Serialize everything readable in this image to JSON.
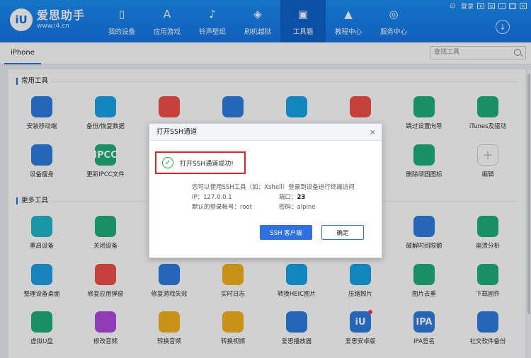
{
  "app": {
    "name": "爱思助手",
    "url": "www.i4.cn",
    "logo_text": "iU"
  },
  "window_controls": {
    "login": "登录"
  },
  "nav": [
    {
      "label": "我的设备",
      "icon": "phone-icon"
    },
    {
      "label": "应用游戏",
      "icon": "app-store-icon"
    },
    {
      "label": "铃声壁纸",
      "icon": "music-icon"
    },
    {
      "label": "刷机越狱",
      "icon": "box-icon"
    },
    {
      "label": "工具箱",
      "icon": "toolbox-icon",
      "active": true
    },
    {
      "label": "教程中心",
      "icon": "graduation-cap-icon"
    },
    {
      "label": "服务中心",
      "icon": "compass-icon"
    }
  ],
  "device_tab": "iPhone",
  "search": {
    "placeholder": "查找工具"
  },
  "sections": {
    "common": "常用工具",
    "more": "更多工具"
  },
  "tools": {
    "common": [
      {
        "label": "安装移动端",
        "color": "#2f7de1"
      },
      {
        "label": "备份/恢复数据",
        "color": "#1aa3e8"
      },
      {
        "label": "",
        "color": "#f0504a"
      },
      {
        "label": "",
        "color": "#2f7de1"
      },
      {
        "label": "",
        "color": "#1aa3e8"
      },
      {
        "label": "",
        "color": "#f0504a"
      },
      {
        "label": "跳过设置向导",
        "color": "#1fb07a"
      },
      {
        "label": "iTunes及驱动",
        "color": "#1fb07a"
      },
      {
        "label": "设备瘦身",
        "color": "#2f7de1"
      },
      {
        "label": "更新IPCC文件",
        "color": "#1fb07a",
        "text": "IPCC"
      },
      {
        "label": "删除顽固图标",
        "color": "#1fb07a"
      },
      {
        "label": "编辑",
        "plus": true
      }
    ],
    "more": [
      {
        "label": "重启设备",
        "color": "#1fb9c9"
      },
      {
        "label": "关闭设备",
        "color": "#1fb07a"
      },
      {
        "label": "破解时间限额",
        "color": "#2f7de1"
      },
      {
        "label": "崩溃分析",
        "color": "#1fb07a"
      },
      {
        "label": "整理设备桌面",
        "color": "#1fa0e8"
      },
      {
        "label": "修复应用弹窗",
        "color": "#f0504a"
      },
      {
        "label": "修复游戏失效",
        "color": "#2f7de1"
      },
      {
        "label": "实时日志",
        "color": "#f4b21e"
      },
      {
        "label": "转换HEIC图片",
        "color": "#1aa3e8"
      },
      {
        "label": "压缩照片",
        "color": "#1aa3e8"
      },
      {
        "label": "图片去重",
        "color": "#1fb07a"
      },
      {
        "label": "下载固件",
        "color": "#1fb07a"
      },
      {
        "label": "虚拟U盘",
        "color": "#1fb07a"
      },
      {
        "label": "修改音频",
        "color": "#b04ae0"
      },
      {
        "label": "转换音频",
        "color": "#f4b21e"
      },
      {
        "label": "转换视频",
        "color": "#f4b21e"
      },
      {
        "label": "爱思播放器",
        "color": "#2f7de1"
      },
      {
        "label": "爱思安卓版",
        "color": "#2f7de1",
        "text": "iU"
      },
      {
        "label": "IPA签名",
        "color": "#2f7de1",
        "text": "IPA"
      },
      {
        "label": "社交软件备份",
        "color": "#2f7de1"
      }
    ]
  },
  "dialog": {
    "title": "打开SSH通道",
    "close": "×",
    "success": "打开SSH通道成功!",
    "info_line": "您可以使用SSH工具（如：Xshell）登录到设备进行终端访问",
    "ip_label": "IP：",
    "ip": "127.0.0.1",
    "port_label": "端口：",
    "port": "23",
    "user_label": "默认的登录帐号：",
    "user": "root",
    "pwd_label": "密码：",
    "pwd": "alpine",
    "btn_ssh": "SSH 客户端",
    "btn_ok": "确定"
  }
}
